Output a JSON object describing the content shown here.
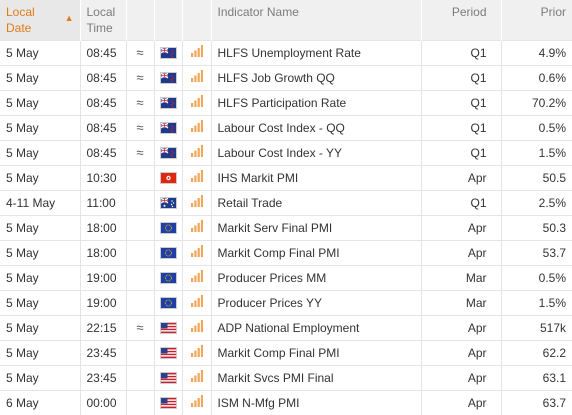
{
  "headers": {
    "date": "Local Date",
    "time": "Local Time",
    "indicator": "Indicator Name",
    "period": "Period",
    "prior": "Prior"
  },
  "colors": {
    "accent": "#e07b1a",
    "importance_bar": "#f0a65a",
    "header_bg": "#f0f0f0"
  },
  "rows": [
    {
      "date": "5 May",
      "time": "08:45",
      "revised": "≈",
      "flag": "nz-flag-icon",
      "name": "HLFS Unemployment Rate",
      "period": "Q1",
      "prior": "4.9%"
    },
    {
      "date": "5 May",
      "time": "08:45",
      "revised": "≈",
      "flag": "nz-flag-icon",
      "name": "HLFS Job Growth QQ",
      "period": "Q1",
      "prior": "0.6%"
    },
    {
      "date": "5 May",
      "time": "08:45",
      "revised": "≈",
      "flag": "nz-flag-icon",
      "name": "HLFS Participation Rate",
      "period": "Q1",
      "prior": "70.2%"
    },
    {
      "date": "5 May",
      "time": "08:45",
      "revised": "≈",
      "flag": "nz-flag-icon",
      "name": "Labour Cost Index - QQ",
      "period": "Q1",
      "prior": "0.5%"
    },
    {
      "date": "5 May",
      "time": "08:45",
      "revised": "≈",
      "flag": "nz-flag-icon",
      "name": "Labour Cost Index - YY",
      "period": "Q1",
      "prior": "1.5%"
    },
    {
      "date": "5 May",
      "time": "10:30",
      "revised": "",
      "flag": "hk-flag-icon",
      "name": "IHS Markit PMI",
      "period": "Apr",
      "prior": "50.5"
    },
    {
      "date": "4-11 May",
      "time": "11:00",
      "revised": "",
      "flag": "au-flag-icon",
      "name": "Retail Trade",
      "period": "Q1",
      "prior": "2.5%"
    },
    {
      "date": "5 May",
      "time": "18:00",
      "revised": "",
      "flag": "eu-flag-icon",
      "name": "Markit Serv Final PMI",
      "period": "Apr",
      "prior": "50.3"
    },
    {
      "date": "5 May",
      "time": "18:00",
      "revised": "",
      "flag": "eu-flag-icon",
      "name": "Markit Comp Final PMI",
      "period": "Apr",
      "prior": "53.7"
    },
    {
      "date": "5 May",
      "time": "19:00",
      "revised": "",
      "flag": "eu-flag-icon",
      "name": "Producer Prices MM",
      "period": "Mar",
      "prior": "0.5%"
    },
    {
      "date": "5 May",
      "time": "19:00",
      "revised": "",
      "flag": "eu-flag-icon",
      "name": "Producer Prices YY",
      "period": "Mar",
      "prior": "1.5%"
    },
    {
      "date": "5 May",
      "time": "22:15",
      "revised": "≈",
      "flag": "us-flag-icon",
      "name": "ADP National Employment",
      "period": "Apr",
      "prior": "517k"
    },
    {
      "date": "5 May",
      "time": "23:45",
      "revised": "",
      "flag": "us-flag-icon",
      "name": "Markit Comp Final PMI",
      "period": "Apr",
      "prior": "62.2"
    },
    {
      "date": "5 May",
      "time": "23:45",
      "revised": "",
      "flag": "us-flag-icon",
      "name": "Markit Svcs PMI Final",
      "period": "Apr",
      "prior": "63.1"
    },
    {
      "date": "6 May",
      "time": "00:00",
      "revised": "",
      "flag": "us-flag-icon",
      "name": "ISM N-Mfg PMI",
      "period": "Apr",
      "prior": "63.7"
    }
  ]
}
